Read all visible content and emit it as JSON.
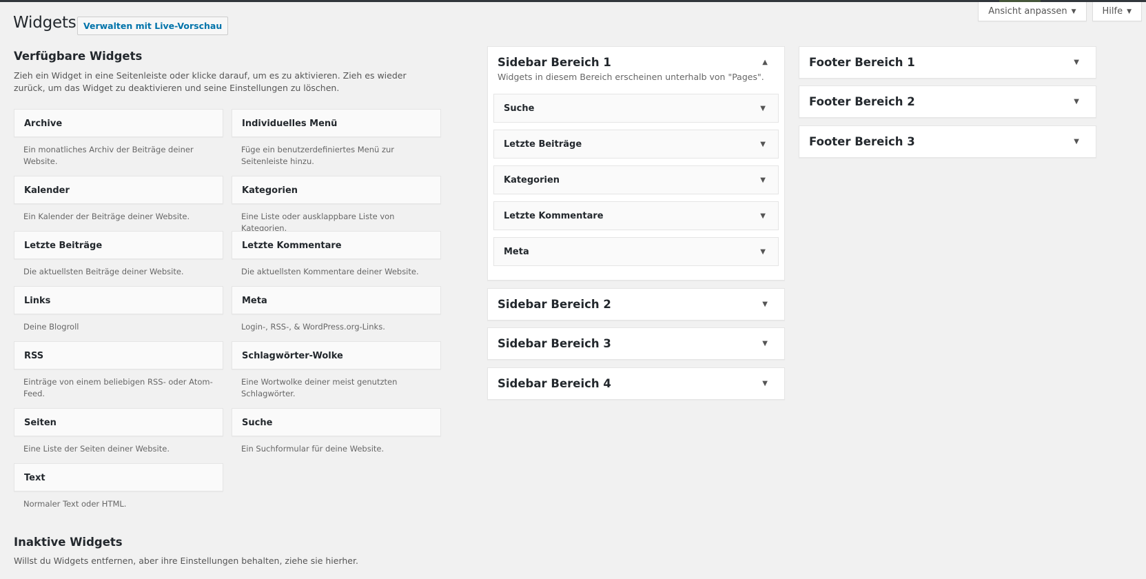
{
  "screen_meta": {
    "screen_options_label": "Ansicht anpassen",
    "help_label": "Hilfe",
    "caret": "▼"
  },
  "page": {
    "title": "Widgets",
    "live_preview_label": "Verwalten mit Live-Vorschau"
  },
  "available": {
    "title": "Verfügbare Widgets",
    "description": "Zieh ein Widget in eine Seitenleiste oder klicke darauf, um es zu aktivieren. Zieh es wieder zurück, um das Widget zu deaktivieren und seine Einstellungen zu löschen.",
    "widgets": [
      {
        "title": "Archive",
        "desc": "Ein monatliches Archiv der Beiträge deiner Website."
      },
      {
        "title": "Individuelles Menü",
        "desc": "Füge ein benutzerdefiniertes Menü zur Seitenleiste hinzu."
      },
      {
        "title": "Kalender",
        "desc": "Ein Kalender der Beiträge deiner Website."
      },
      {
        "title": "Kategorien",
        "desc": "Eine Liste oder ausklappbare Liste von Kategorien."
      },
      {
        "title": "Letzte Beiträge",
        "desc": "Die aktuellsten Beiträge deiner Website."
      },
      {
        "title": "Letzte Kommentare",
        "desc": "Die aktuellsten Kommentare deiner Website."
      },
      {
        "title": "Links",
        "desc": "Deine Blogroll"
      },
      {
        "title": "Meta",
        "desc": "Login-, RSS-, & WordPress.org-Links."
      },
      {
        "title": "RSS",
        "desc": "Einträge von einem beliebigen RSS- oder Atom-Feed."
      },
      {
        "title": "Schlagwörter-Wolke",
        "desc": "Eine Wortwolke deiner meist genutzten Schlagwörter."
      },
      {
        "title": "Seiten",
        "desc": "Eine Liste der Seiten deiner Website."
      },
      {
        "title": "Suche",
        "desc": "Ein Suchformular für deine Website."
      },
      {
        "title": "Text",
        "desc": "Normaler Text oder HTML."
      }
    ]
  },
  "inactive": {
    "title": "Inaktive Widgets",
    "description": "Willst du Widgets entfernen, aber ihre Einstellungen behalten, ziehe sie hierher."
  },
  "sidebars": [
    {
      "title": "Sidebar Bereich 1",
      "toggle": "▲",
      "description": "Widgets in diesem Bereich erscheinen unterhalb von \"Pages\".",
      "widgets": [
        "Suche",
        "Letzte Beiträge",
        "Kategorien",
        "Letzte Kommentare",
        "Meta"
      ]
    },
    {
      "title": "Sidebar Bereich 2",
      "toggle": "▼"
    },
    {
      "title": "Sidebar Bereich 3",
      "toggle": "▼"
    },
    {
      "title": "Sidebar Bereich 4",
      "toggle": "▼"
    }
  ],
  "footers": [
    {
      "title": "Footer Bereich 1",
      "toggle": "▼"
    },
    {
      "title": "Footer Bereich 2",
      "toggle": "▼"
    },
    {
      "title": "Footer Bereich 3",
      "toggle": "▼"
    }
  ],
  "widget_toggle": "▼"
}
